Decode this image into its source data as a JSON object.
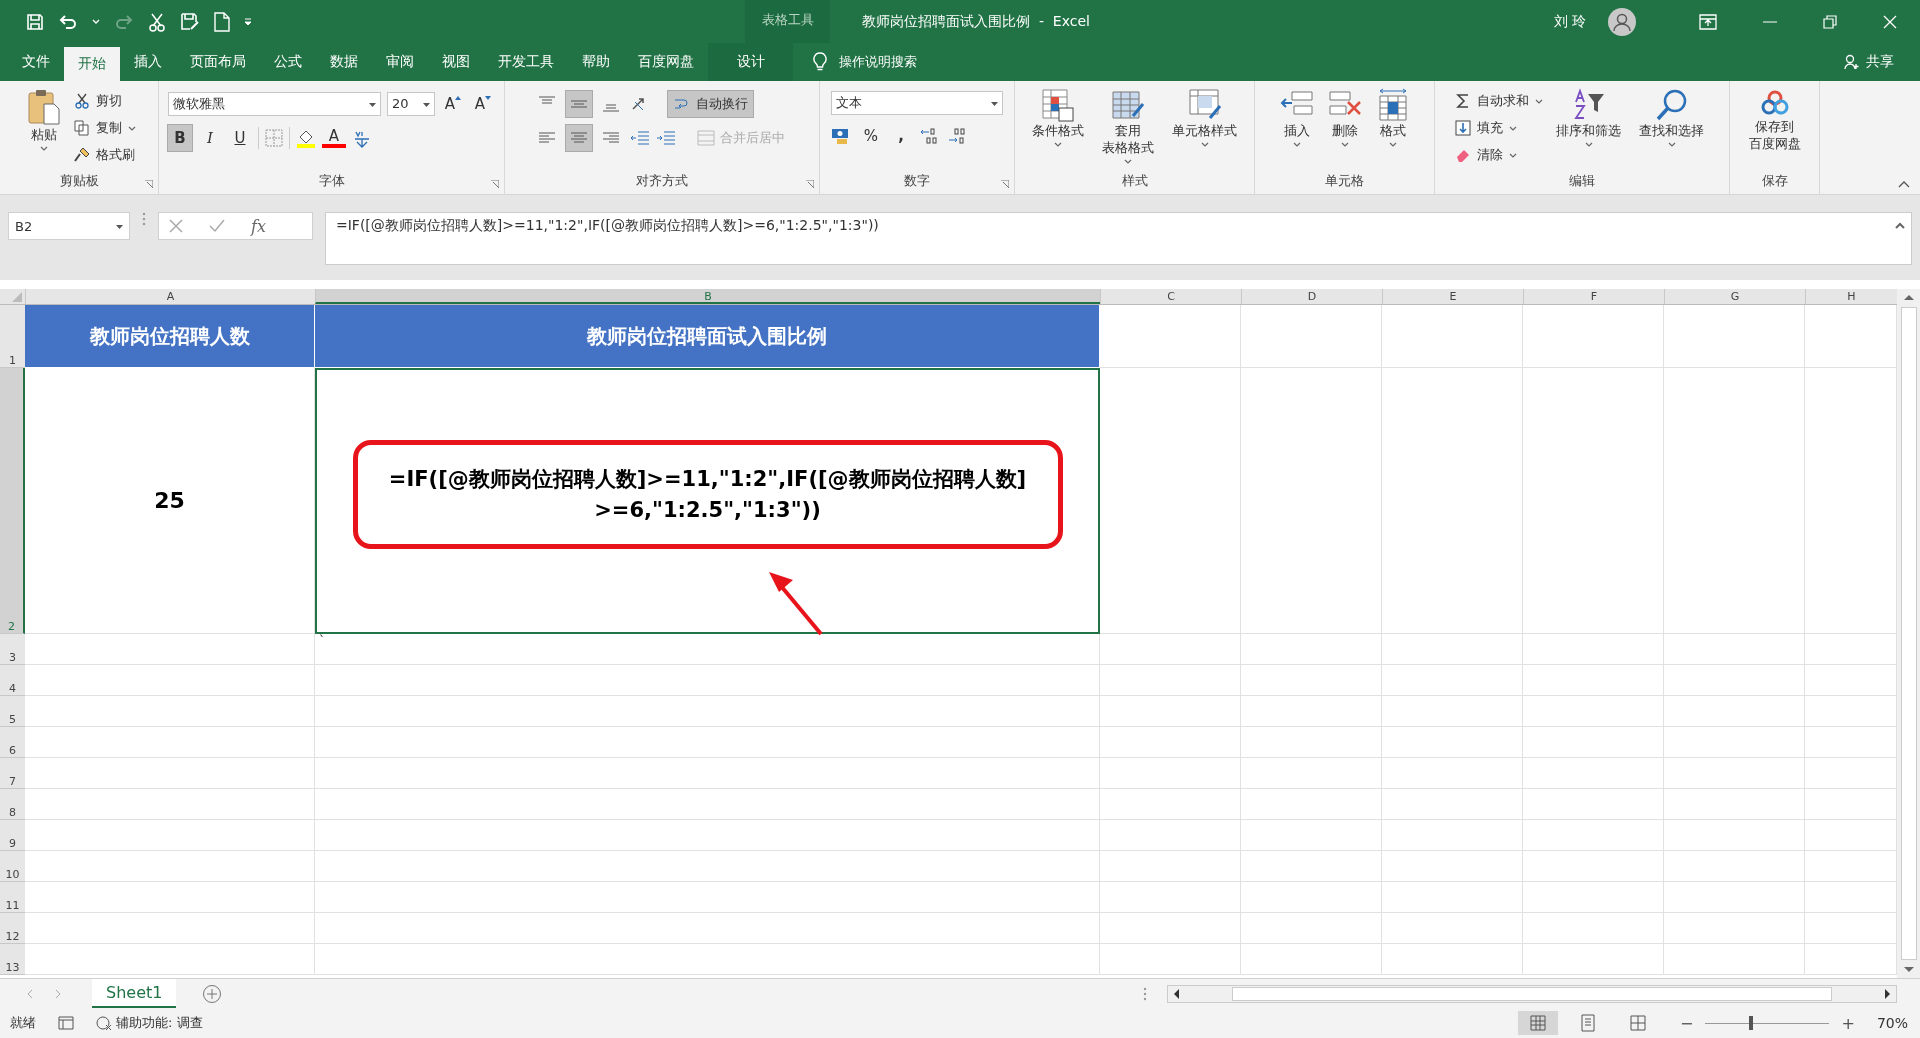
{
  "window": {
    "context_label": "表格工具",
    "title": "教师岗位招聘面试入围比例  -  Excel",
    "user": "刘 玲"
  },
  "tabs": [
    {
      "label": "文件",
      "selected": false,
      "kind": "normal"
    },
    {
      "label": "开始",
      "selected": true,
      "kind": "normal"
    },
    {
      "label": "插入",
      "selected": false,
      "kind": "normal"
    },
    {
      "label": "页面布局",
      "selected": false,
      "kind": "normal"
    },
    {
      "label": "公式",
      "selected": false,
      "kind": "normal"
    },
    {
      "label": "数据",
      "selected": false,
      "kind": "normal"
    },
    {
      "label": "审阅",
      "selected": false,
      "kind": "normal"
    },
    {
      "label": "视图",
      "selected": false,
      "kind": "normal"
    },
    {
      "label": "开发工具",
      "selected": false,
      "kind": "normal"
    },
    {
      "label": "帮助",
      "selected": false,
      "kind": "normal"
    },
    {
      "label": "百度网盘",
      "selected": false,
      "kind": "normal"
    },
    {
      "label": "设计",
      "selected": false,
      "kind": "contextual"
    }
  ],
  "tell_me": {
    "placeholder": "操作说明搜索"
  },
  "share": "共享",
  "ribbon": {
    "clipboard": {
      "label": "剪贴板",
      "paste": "粘贴",
      "cut": "剪切",
      "copy": "复制",
      "format_painter": "格式刷"
    },
    "font": {
      "label": "字体",
      "font_name": "微软雅黑",
      "font_size": "20",
      "grow": "A",
      "shrink": "A",
      "bold": {
        "label": "B",
        "on": true
      },
      "italic": "I",
      "underline": "U",
      "font_color": "A"
    },
    "alignment": {
      "label": "对齐方式",
      "vertical": [
        {
          "kind": "top",
          "selected": false
        },
        {
          "kind": "middle",
          "selected": true
        },
        {
          "kind": "bottom",
          "selected": false
        }
      ],
      "horizontal": [
        {
          "kind": "left",
          "selected": false
        },
        {
          "kind": "center",
          "selected": true
        },
        {
          "kind": "right",
          "selected": false
        }
      ],
      "wrap_text": {
        "label": "自动换行",
        "on": true
      },
      "merge": {
        "label": "合并后居中",
        "disabled": true
      }
    },
    "number": {
      "label": "数字",
      "format": "文本",
      "percent": "%",
      "comma": ","
    },
    "styles": {
      "label": "样式",
      "buttons": [
        {
          "lines": [
            "条件格式"
          ],
          "kind": "conditional"
        },
        {
          "lines": [
            "套用",
            "表格格式"
          ],
          "kind": "table"
        },
        {
          "lines": [
            "单元格样式"
          ],
          "kind": "cell"
        }
      ]
    },
    "cells": {
      "label": "单元格",
      "buttons": [
        {
          "label": "插入",
          "kind": "insert"
        },
        {
          "label": "删除",
          "kind": "delete"
        },
        {
          "label": "格式",
          "kind": "format"
        }
      ]
    },
    "editing": {
      "label": "编辑",
      "small": [
        {
          "label": "自动求和",
          "kind": "sum"
        },
        {
          "label": "填充",
          "kind": "fill"
        },
        {
          "label": "清除",
          "kind": "clear"
        }
      ],
      "large": [
        {
          "label": "排序和筛选",
          "kind": "sort"
        },
        {
          "label": "查找和选择",
          "kind": "find"
        }
      ]
    },
    "save": {
      "label": "保存",
      "lines": [
        "保存到",
        "百度网盘"
      ]
    }
  },
  "formula_bar": {
    "name_box": "B2",
    "fx": "fx",
    "formula": "=IF([@教师岗位招聘人数]>=11,\"1:2\",IF([@教师岗位招聘人数]>=6,\"1:2.5\",\"1:3\"))"
  },
  "columns": [
    {
      "label": "A",
      "selected": false
    },
    {
      "label": "B",
      "selected": true
    },
    {
      "label": "C",
      "selected": false
    },
    {
      "label": "D",
      "selected": false
    },
    {
      "label": "E",
      "selected": false
    },
    {
      "label": "F",
      "selected": false
    },
    {
      "label": "G",
      "selected": false
    },
    {
      "label": "H",
      "selected": false
    }
  ],
  "rows": [
    {
      "label": "1",
      "selected": false,
      "cells": [
        {
          "value": "教师岗位招聘人数",
          "kind": "header",
          "selected": false
        },
        {
          "value": "教师岗位招聘面试入围比例",
          "kind": "header",
          "selected": false
        }
      ]
    },
    {
      "label": "2",
      "selected": true,
      "cells": [
        {
          "value": "25",
          "kind": "number",
          "selected": false
        },
        {
          "value": "=IF([@教师岗位招聘人数]>=11,\"1:2\",IF([@教师岗位招聘人数]>=6,\"1:2.5\",\"1:3\"))",
          "kind": "annotated",
          "selected": true
        }
      ]
    },
    {
      "label": "3",
      "selected": false,
      "cells": [
        {
          "kind": "empty",
          "selected": false
        },
        {
          "value": "`",
          "kind": "plain",
          "selected": false
        }
      ]
    },
    {
      "label": "4",
      "selected": false
    },
    {
      "label": "5",
      "selected": false
    },
    {
      "label": "6",
      "selected": false
    },
    {
      "label": "7",
      "selected": false
    },
    {
      "label": "8",
      "selected": false
    },
    {
      "label": "9",
      "selected": false
    },
    {
      "label": "10",
      "selected": false
    },
    {
      "label": "11",
      "selected": false
    },
    {
      "label": "12",
      "selected": false
    },
    {
      "label": "13",
      "selected": false
    }
  ],
  "sheet_tabs": [
    {
      "label": "Sheet1",
      "selected": true
    }
  ],
  "status_bar": {
    "ready": "就绪",
    "accessibility": "辅助功能: 调查",
    "views": [
      {
        "kind": "normal",
        "selected": true
      },
      {
        "kind": "page_layout",
        "selected": false
      },
      {
        "kind": "page_break",
        "selected": false
      }
    ],
    "zoom_out": "−",
    "zoom_in": "+",
    "zoom_slider": {
      "level": 0.35
    },
    "zoom": "70%"
  }
}
